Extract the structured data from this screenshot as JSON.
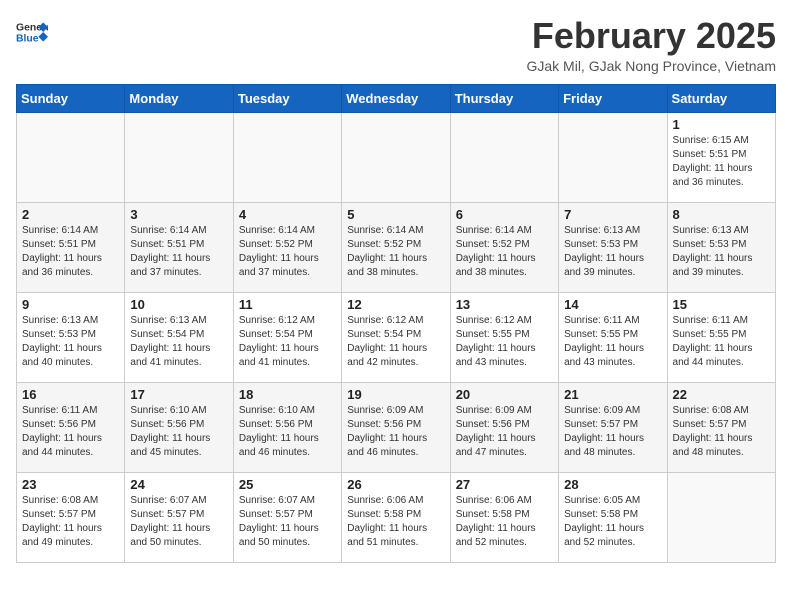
{
  "header": {
    "logo_general": "General",
    "logo_blue": "Blue",
    "month_year": "February 2025",
    "location": "GJak Mil, GJak Nong Province, Vietnam"
  },
  "days_of_week": [
    "Sunday",
    "Monday",
    "Tuesday",
    "Wednesday",
    "Thursday",
    "Friday",
    "Saturday"
  ],
  "weeks": [
    [
      {
        "day": "",
        "info": ""
      },
      {
        "day": "",
        "info": ""
      },
      {
        "day": "",
        "info": ""
      },
      {
        "day": "",
        "info": ""
      },
      {
        "day": "",
        "info": ""
      },
      {
        "day": "",
        "info": ""
      },
      {
        "day": "1",
        "info": "Sunrise: 6:15 AM\nSunset: 5:51 PM\nDaylight: 11 hours\nand 36 minutes."
      }
    ],
    [
      {
        "day": "2",
        "info": "Sunrise: 6:14 AM\nSunset: 5:51 PM\nDaylight: 11 hours\nand 36 minutes."
      },
      {
        "day": "3",
        "info": "Sunrise: 6:14 AM\nSunset: 5:51 PM\nDaylight: 11 hours\nand 37 minutes."
      },
      {
        "day": "4",
        "info": "Sunrise: 6:14 AM\nSunset: 5:52 PM\nDaylight: 11 hours\nand 37 minutes."
      },
      {
        "day": "5",
        "info": "Sunrise: 6:14 AM\nSunset: 5:52 PM\nDaylight: 11 hours\nand 38 minutes."
      },
      {
        "day": "6",
        "info": "Sunrise: 6:14 AM\nSunset: 5:52 PM\nDaylight: 11 hours\nand 38 minutes."
      },
      {
        "day": "7",
        "info": "Sunrise: 6:13 AM\nSunset: 5:53 PM\nDaylight: 11 hours\nand 39 minutes."
      },
      {
        "day": "8",
        "info": "Sunrise: 6:13 AM\nSunset: 5:53 PM\nDaylight: 11 hours\nand 39 minutes."
      }
    ],
    [
      {
        "day": "9",
        "info": "Sunrise: 6:13 AM\nSunset: 5:53 PM\nDaylight: 11 hours\nand 40 minutes."
      },
      {
        "day": "10",
        "info": "Sunrise: 6:13 AM\nSunset: 5:54 PM\nDaylight: 11 hours\nand 41 minutes."
      },
      {
        "day": "11",
        "info": "Sunrise: 6:12 AM\nSunset: 5:54 PM\nDaylight: 11 hours\nand 41 minutes."
      },
      {
        "day": "12",
        "info": "Sunrise: 6:12 AM\nSunset: 5:54 PM\nDaylight: 11 hours\nand 42 minutes."
      },
      {
        "day": "13",
        "info": "Sunrise: 6:12 AM\nSunset: 5:55 PM\nDaylight: 11 hours\nand 43 minutes."
      },
      {
        "day": "14",
        "info": "Sunrise: 6:11 AM\nSunset: 5:55 PM\nDaylight: 11 hours\nand 43 minutes."
      },
      {
        "day": "15",
        "info": "Sunrise: 6:11 AM\nSunset: 5:55 PM\nDaylight: 11 hours\nand 44 minutes."
      }
    ],
    [
      {
        "day": "16",
        "info": "Sunrise: 6:11 AM\nSunset: 5:56 PM\nDaylight: 11 hours\nand 44 minutes."
      },
      {
        "day": "17",
        "info": "Sunrise: 6:10 AM\nSunset: 5:56 PM\nDaylight: 11 hours\nand 45 minutes."
      },
      {
        "day": "18",
        "info": "Sunrise: 6:10 AM\nSunset: 5:56 PM\nDaylight: 11 hours\nand 46 minutes."
      },
      {
        "day": "19",
        "info": "Sunrise: 6:09 AM\nSunset: 5:56 PM\nDaylight: 11 hours\nand 46 minutes."
      },
      {
        "day": "20",
        "info": "Sunrise: 6:09 AM\nSunset: 5:56 PM\nDaylight: 11 hours\nand 47 minutes."
      },
      {
        "day": "21",
        "info": "Sunrise: 6:09 AM\nSunset: 5:57 PM\nDaylight: 11 hours\nand 48 minutes."
      },
      {
        "day": "22",
        "info": "Sunrise: 6:08 AM\nSunset: 5:57 PM\nDaylight: 11 hours\nand 48 minutes."
      }
    ],
    [
      {
        "day": "23",
        "info": "Sunrise: 6:08 AM\nSunset: 5:57 PM\nDaylight: 11 hours\nand 49 minutes."
      },
      {
        "day": "24",
        "info": "Sunrise: 6:07 AM\nSunset: 5:57 PM\nDaylight: 11 hours\nand 50 minutes."
      },
      {
        "day": "25",
        "info": "Sunrise: 6:07 AM\nSunset: 5:57 PM\nDaylight: 11 hours\nand 50 minutes."
      },
      {
        "day": "26",
        "info": "Sunrise: 6:06 AM\nSunset: 5:58 PM\nDaylight: 11 hours\nand 51 minutes."
      },
      {
        "day": "27",
        "info": "Sunrise: 6:06 AM\nSunset: 5:58 PM\nDaylight: 11 hours\nand 52 minutes."
      },
      {
        "day": "28",
        "info": "Sunrise: 6:05 AM\nSunset: 5:58 PM\nDaylight: 11 hours\nand 52 minutes."
      },
      {
        "day": "",
        "info": ""
      }
    ]
  ]
}
